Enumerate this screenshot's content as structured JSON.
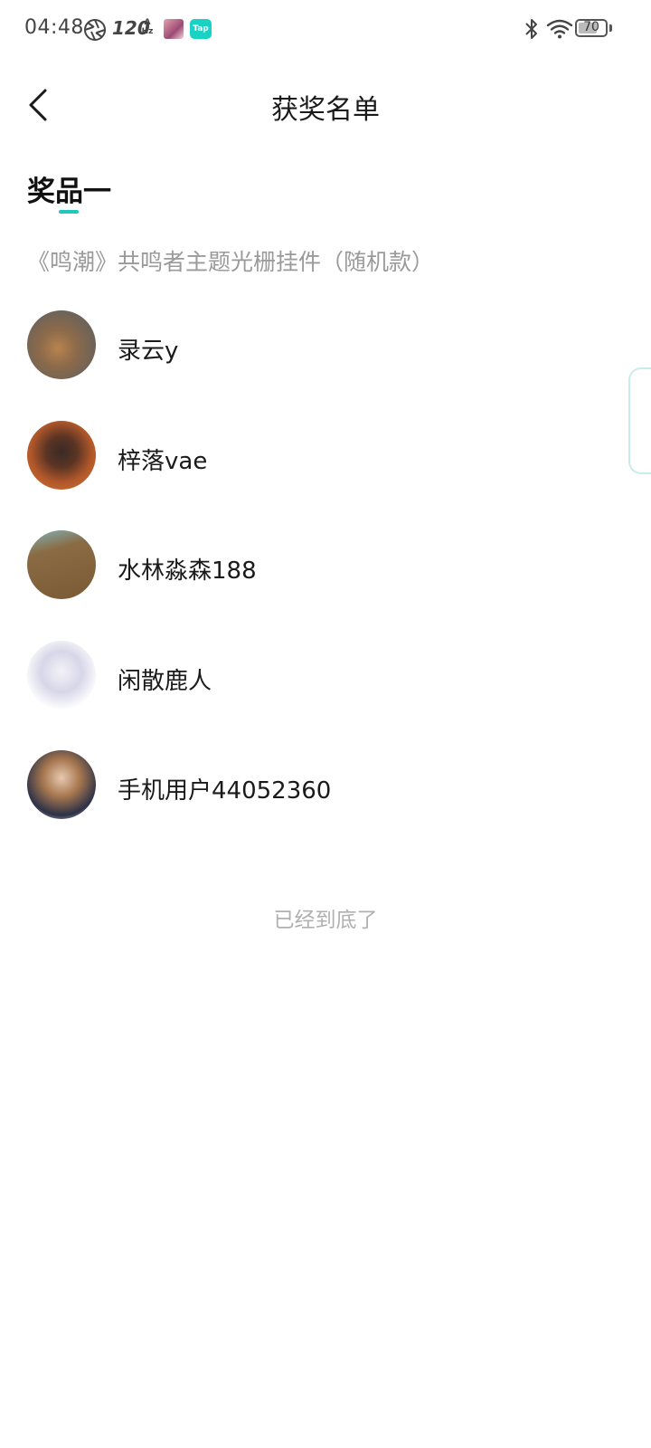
{
  "status_bar": {
    "time": "04:48",
    "refresh_rate": "120",
    "refresh_unit_top": "A",
    "refresh_unit_bottom": "Hz",
    "tap_badge": "Tap",
    "battery": "70",
    "battery_level": 0.7,
    "tap_color": "#19d2c4"
  },
  "header": {
    "title": "获奖名单",
    "back_icon": "chevron-left-icon"
  },
  "prize": {
    "heading": "奖品一",
    "accent_color": "#1fc7bd",
    "description": "《鸣潮》共鸣者主题光栅挂件（随机款）"
  },
  "winners": [
    {
      "name": "录云y",
      "avatar": "chicken-photo-avatar"
    },
    {
      "name": "梓落vae",
      "avatar": "anime-character-avatar"
    },
    {
      "name": "水林淼森188",
      "avatar": "pen-photo-avatar"
    },
    {
      "name": "闲散鹿人",
      "avatar": "white-hair-anime-avatar"
    },
    {
      "name": "手机用户44052360",
      "avatar": "anime-girl-guitar-avatar"
    }
  ],
  "list_end": "已经到底了"
}
